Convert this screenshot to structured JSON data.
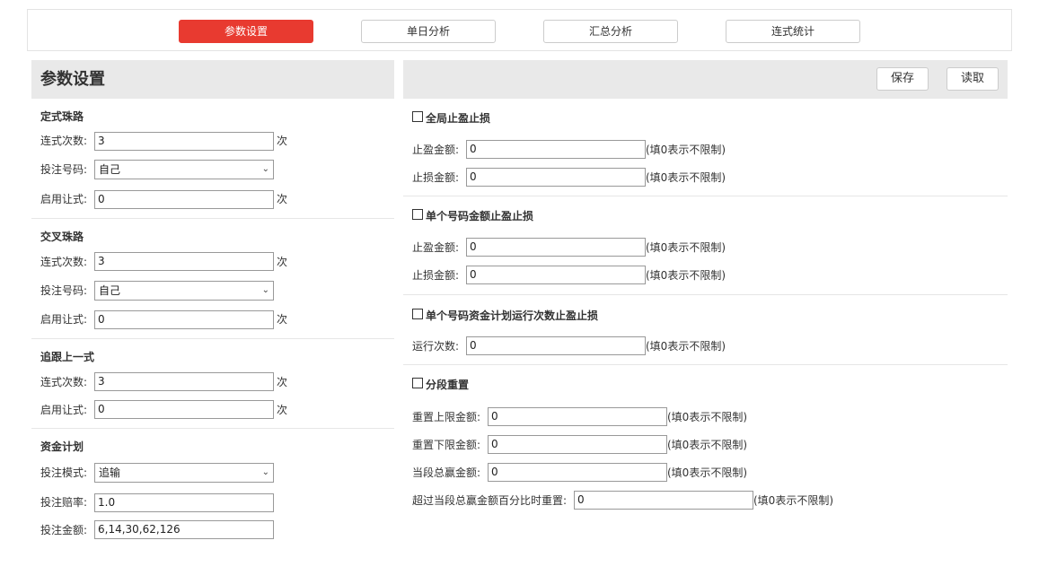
{
  "tabs": [
    "参数设置",
    "单日分析",
    "汇总分析",
    "连式统计"
  ],
  "left": {
    "title": "参数设置",
    "fixed": {
      "title": "定式珠路",
      "count_label": "连式次数:",
      "count_value": "3",
      "count_unit": "次",
      "number_label": "投注号码:",
      "number_value": "自己",
      "concede_label": "启用让式:",
      "concede_value": "0",
      "concede_unit": "次"
    },
    "cross": {
      "title": "交叉珠路",
      "count_label": "连式次数:",
      "count_value": "3",
      "count_unit": "次",
      "number_label": "投注号码:",
      "number_value": "自己",
      "concede_label": "启用让式:",
      "concede_value": "0",
      "concede_unit": "次"
    },
    "follow": {
      "title": "追跟上一式",
      "count_label": "连式次数:",
      "count_value": "3",
      "count_unit": "次",
      "concede_label": "启用让式:",
      "concede_value": "0",
      "concede_unit": "次"
    },
    "plan": {
      "title": "资金计划",
      "mode_label": "投注模式:",
      "mode_value": "追输",
      "odds_label": "投注赔率:",
      "odds_value": "1.0",
      "amount_label": "投注金额:",
      "amount_value": "6,14,30,62,126"
    }
  },
  "right": {
    "save_label": "保存",
    "load_label": "读取",
    "hint": "(填0表示不限制)",
    "global": {
      "title": "全局止盈止损",
      "tp_label": "止盈金额:",
      "tp_value": "0",
      "sl_label": "止损金额:",
      "sl_value": "0"
    },
    "single": {
      "title": "单个号码金额止盈止损",
      "tp_label": "止盈金额:",
      "tp_value": "0",
      "sl_label": "止损金额:",
      "sl_value": "0"
    },
    "runs": {
      "title": "单个号码资金计划运行次数止盈止损",
      "label": "运行次数:",
      "value": "0"
    },
    "reset": {
      "title": "分段重置",
      "upper_label": "重置上限金额:",
      "upper_value": "0",
      "lower_label": "重置下限金额:",
      "lower_value": "0",
      "win_label": "当段总赢金额:",
      "win_value": "0",
      "pct_label": "超过当段总赢金额百分比时重置:",
      "pct_value": "0"
    }
  }
}
